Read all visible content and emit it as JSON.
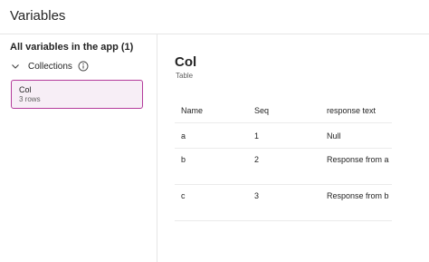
{
  "header": {
    "title": "Variables"
  },
  "sidebar": {
    "all_variables_label": "All variables in the app (1)",
    "collections_label": "Collections",
    "cards": [
      {
        "name": "Col",
        "rows": "3 rows"
      }
    ]
  },
  "main": {
    "title": "Col",
    "subtitle": "Table",
    "table": {
      "columns": [
        "Name",
        "Seq",
        "response text"
      ],
      "rows": [
        [
          "a",
          "1",
          "Null"
        ],
        [
          "b",
          "2",
          "Response from a"
        ],
        [
          "c",
          "3",
          "Response from b"
        ]
      ]
    }
  },
  "colors": {
    "accent": "#b43b9b",
    "card_background": "#f7eef6",
    "divider": "#e6e6e6"
  },
  "icons": {
    "chevron": "chevron-down-icon",
    "info": "info-icon"
  }
}
